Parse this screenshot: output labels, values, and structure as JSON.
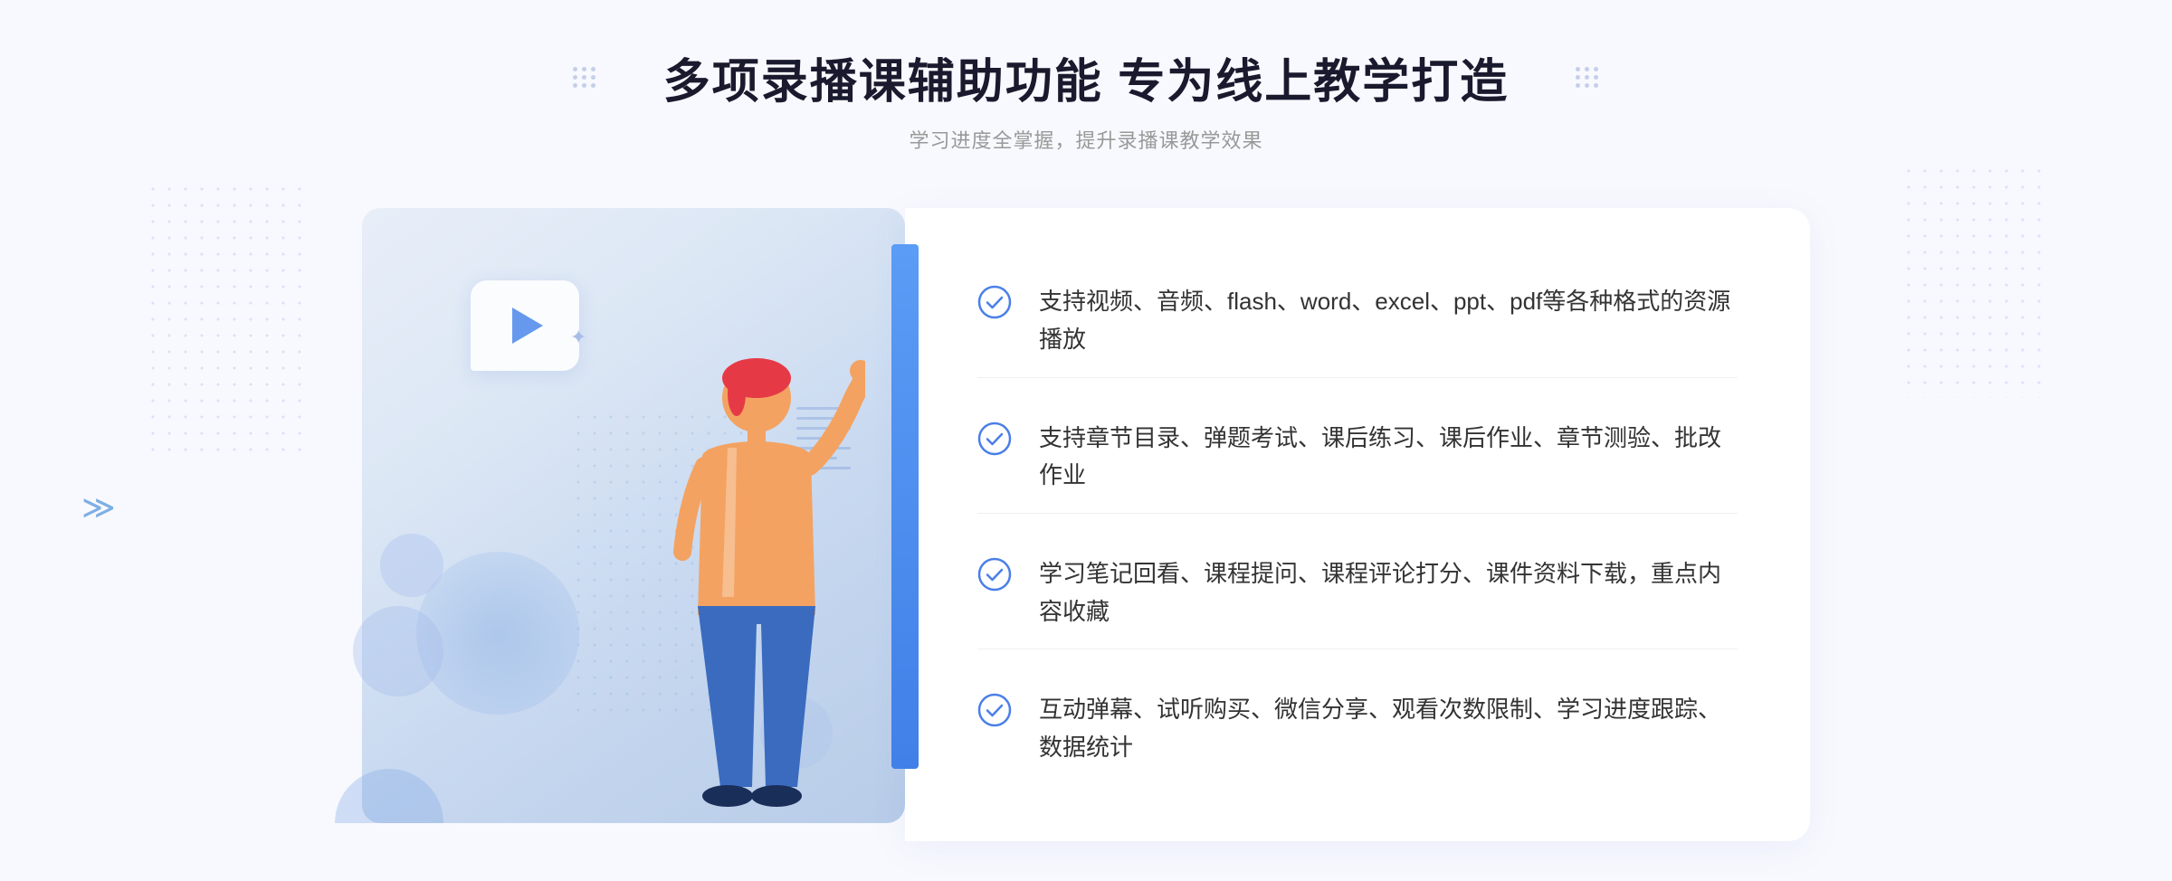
{
  "header": {
    "title": "多项录播课辅助功能 专为线上教学打造",
    "subtitle": "学习进度全掌握，提升录播课教学效果"
  },
  "features": [
    {
      "id": "feature-1",
      "text": "支持视频、音频、flash、word、excel、ppt、pdf等各种格式的资源播放"
    },
    {
      "id": "feature-2",
      "text": "支持章节目录、弹题考试、课后练习、课后作业、章节测验、批改作业"
    },
    {
      "id": "feature-3",
      "text": "学习笔记回看、课程提问、课程评论打分、课件资料下载，重点内容收藏"
    },
    {
      "id": "feature-4",
      "text": "互动弹幕、试听购买、微信分享、观看次数限制、学习进度跟踪、数据统计"
    }
  ],
  "colors": {
    "accent": "#4a7fe8",
    "title": "#1a1a2e",
    "subtitle": "#999999",
    "feature_text": "#333333",
    "check": "#4a7fe8"
  }
}
